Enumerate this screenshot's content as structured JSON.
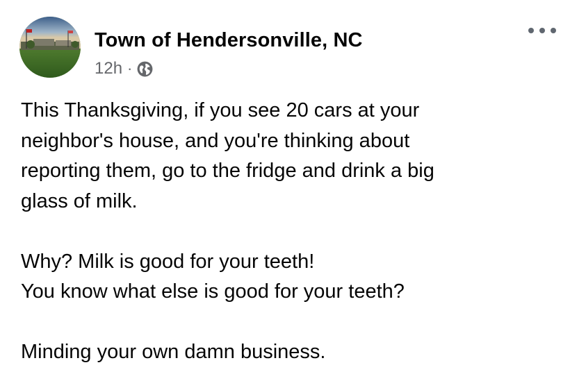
{
  "post": {
    "author": "Town of Hendersonville, NC",
    "timestamp": "12h",
    "separator": "·",
    "audience_icon": "globe-icon",
    "more_icon": "more-options-icon",
    "paragraphs": [
      [
        "This Thanksgiving, if you see 20 cars at your",
        "neighbor's house, and you're thinking about",
        "reporting them, go to the fridge and drink a big",
        "glass of milk."
      ],
      [
        "Why? Milk is good for your teeth!",
        "You know what else is good for your teeth?"
      ],
      [
        "Minding your own damn business."
      ]
    ]
  },
  "colors": {
    "text": "#050505",
    "secondary": "#65676b",
    "background": "#ffffff"
  }
}
